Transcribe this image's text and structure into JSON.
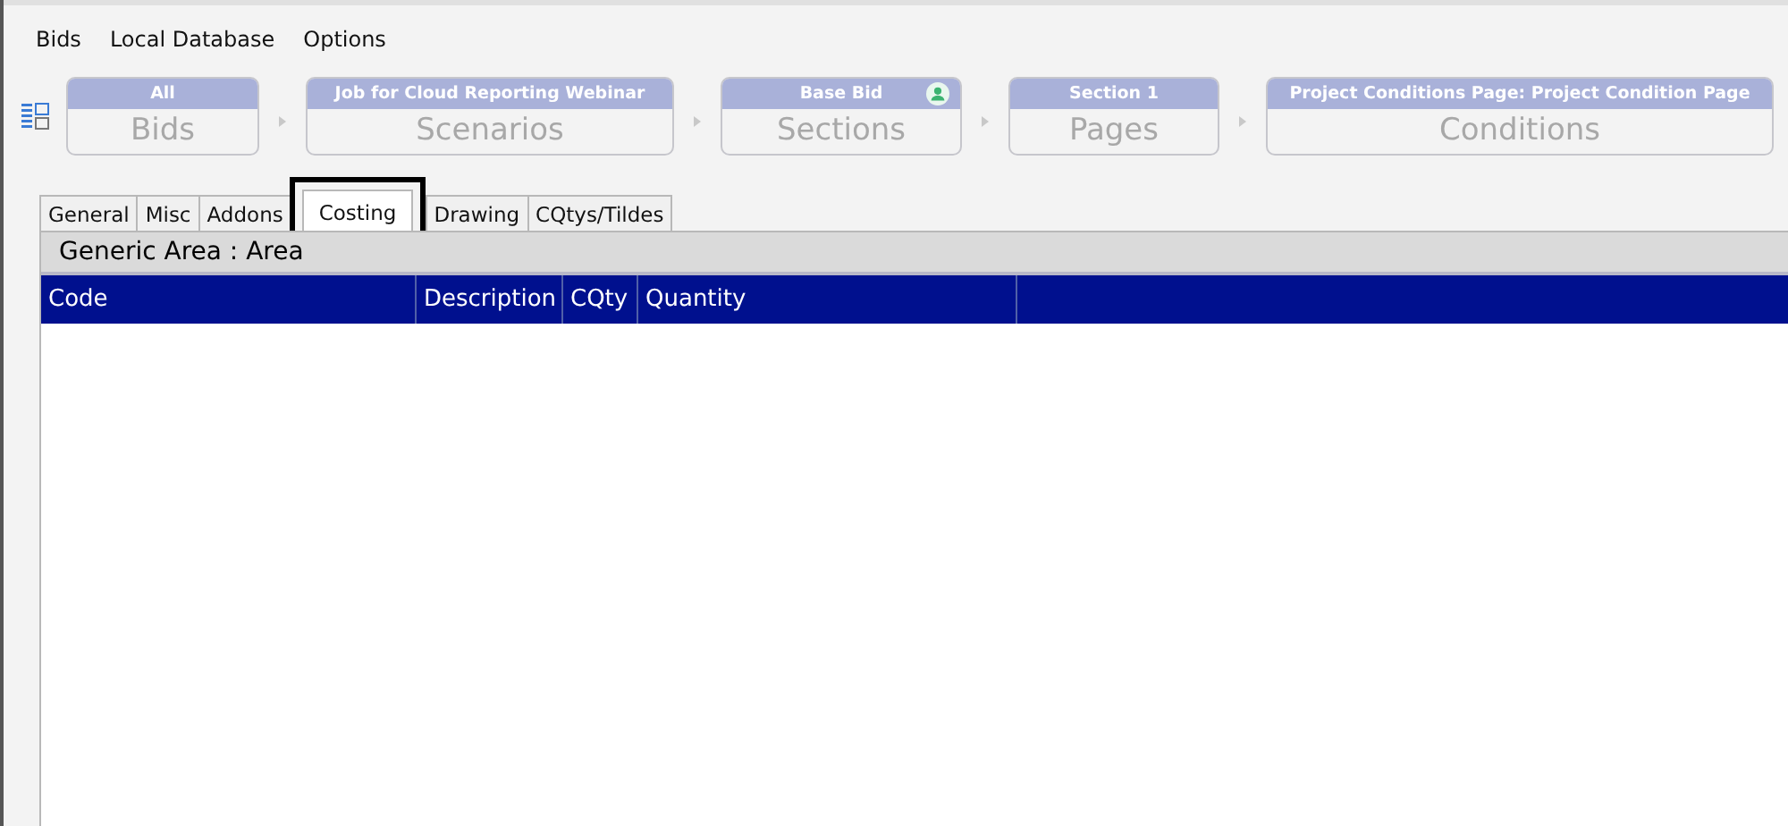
{
  "menu": [
    "Bids",
    "Local Database",
    "Options"
  ],
  "breadcrumbs": [
    {
      "title": "All",
      "label": "Bids",
      "user_badge": false
    },
    {
      "title": "Job for Cloud Reporting Webinar",
      "label": "Scenarios",
      "user_badge": false
    },
    {
      "title": "Base Bid",
      "label": "Sections",
      "user_badge": true
    },
    {
      "title": "Section 1",
      "label": "Pages",
      "user_badge": false
    },
    {
      "title": "Project Conditions Page: Project Condition Page",
      "label": "Conditions",
      "user_badge": false
    }
  ],
  "tabs": [
    {
      "label": "General",
      "selected": false
    },
    {
      "label": "Misc",
      "selected": false
    },
    {
      "label": "Addons",
      "selected": false
    },
    {
      "label": "Costing",
      "selected": true,
      "highlighted": true
    },
    {
      "label": "Drawing",
      "selected": false
    },
    {
      "label": "CQtys/Tildes",
      "selected": false
    }
  ],
  "panel": {
    "title": "Generic Area : Area"
  },
  "table": {
    "columns": [
      "Code",
      "Description",
      "CQty",
      "Quantity"
    ]
  }
}
